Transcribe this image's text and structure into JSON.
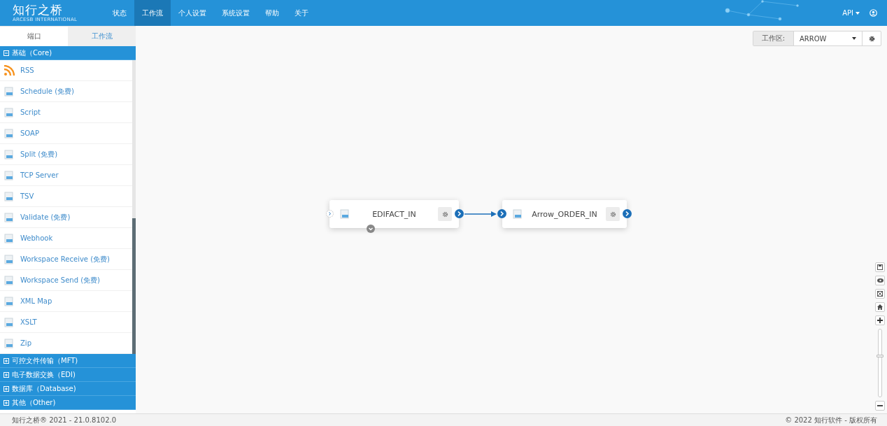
{
  "header": {
    "logo": "知行之桥",
    "logo_subtitle": "ARCESB INTERNATIONAL",
    "nav": [
      {
        "label": "状态",
        "selected": false
      },
      {
        "label": "工作流",
        "selected": true
      },
      {
        "label": "个人设置",
        "selected": false
      },
      {
        "label": "系统设置",
        "selected": false
      },
      {
        "label": "帮助",
        "selected": false
      },
      {
        "label": "关于",
        "selected": false
      }
    ],
    "api_menu": "API"
  },
  "sidebar": {
    "tabs": [
      {
        "label": "端口",
        "selected": true
      },
      {
        "label": "工作流",
        "selected": false
      }
    ],
    "categories": [
      {
        "label": "基础（Core)",
        "expanded": true,
        "items": [
          "RSS",
          "Schedule (免费)",
          "Script",
          "SOAP",
          "Split (免费)",
          "TCP Server",
          "TSV",
          "Validate (免费)",
          "Webhook",
          "Workspace Receive (免费)",
          "Workspace Send (免费)",
          "XML Map",
          "XSLT",
          "Zip"
        ]
      },
      {
        "label": "可控文件传输（MFT)",
        "expanded": false
      },
      {
        "label": "电子数据交换（EDI)",
        "expanded": false
      },
      {
        "label": "数据库（Database)",
        "expanded": false
      },
      {
        "label": "其他（Other)",
        "expanded": false
      }
    ]
  },
  "workspace": {
    "label": "工作区:",
    "value": "ARROW"
  },
  "nodes": [
    {
      "label": "EDIFACT_IN"
    },
    {
      "label": "Arrow_ORDER_IN"
    }
  ],
  "zoom": {
    "level": 0.6
  },
  "footer": {
    "left": "知行之桥® 2021 - 21.0.8102.0",
    "right": "© 2022 知行软件 - 版权所有"
  }
}
